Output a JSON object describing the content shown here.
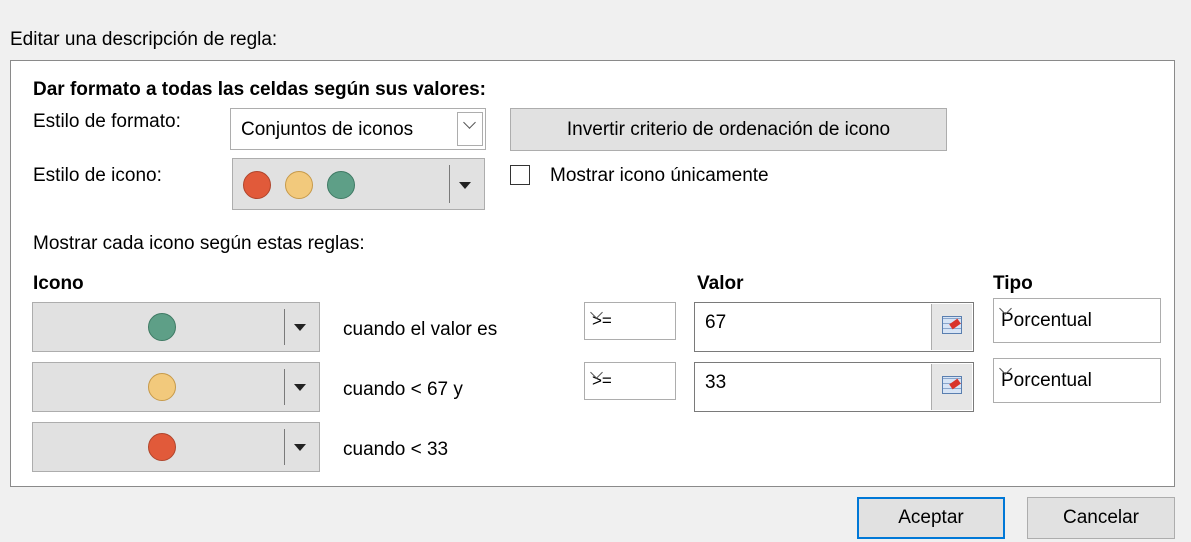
{
  "section_title": "Editar una descripción de regla:",
  "panel": {
    "heading": "Dar formato a todas las celdas según sus valores:",
    "format_style_label": "Estilo de formato:",
    "format_style_value": "Conjuntos de iconos",
    "reverse_button": "Invertir criterio de ordenación de icono",
    "icon_style_label": "Estilo de icono:",
    "icon_style_icons": [
      "red-circle-icon",
      "yellow-circle-icon",
      "green-circle-icon"
    ],
    "show_icon_only_label": "Mostrar icono únicamente",
    "show_icon_only_checked": false,
    "rules_label": "Mostrar cada icono según estas reglas:",
    "headers": {
      "icon": "Icono",
      "value": "Valor",
      "type": "Tipo"
    },
    "rules": [
      {
        "icon": "green-circle-icon",
        "condition": "cuando el valor es",
        "operator": ">=",
        "value": "67",
        "type": "Porcentual"
      },
      {
        "icon": "yellow-circle-icon",
        "condition": "cuando < 67 y",
        "operator": ">=",
        "value": "33",
        "type": "Porcentual"
      },
      {
        "icon": "red-circle-icon",
        "condition": "cuando < 33"
      }
    ]
  },
  "buttons": {
    "ok": "Aceptar",
    "cancel": "Cancelar"
  },
  "colors": {
    "red": "#e15a3a",
    "yellow": "#f2c97c",
    "green": "#5e9f87",
    "accent": "#0078d7"
  }
}
